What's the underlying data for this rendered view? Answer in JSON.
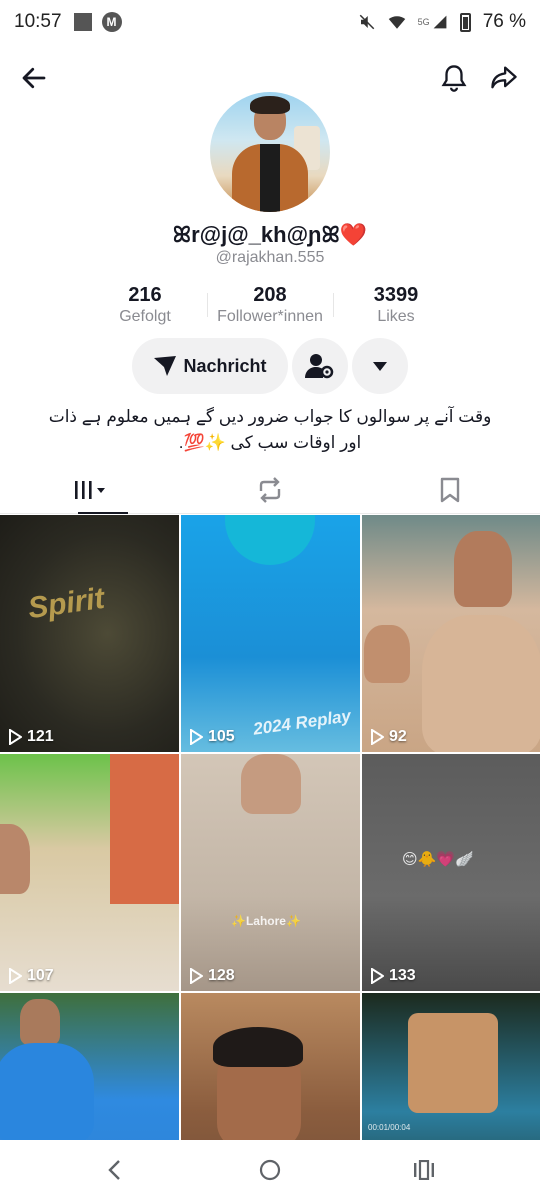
{
  "status_bar": {
    "time": "10:57",
    "battery": "76 %",
    "network": "5G"
  },
  "top_nav": {
    "back_icon": "arrow-left-icon",
    "notification_icon": "bell-icon",
    "share_icon": "share-arrow-icon"
  },
  "profile": {
    "display_name": "ꕤr@j@_kh@ɲꕤ❤️",
    "username": "@rajakhan.555",
    "stats": [
      {
        "value": "216",
        "label": "Gefolgt"
      },
      {
        "value": "208",
        "label": "Follower*innen"
      },
      {
        "value": "3399",
        "label": "Likes"
      }
    ],
    "message_button": "Nachricht",
    "bio_line1": "وقت آنے پر سوالوں کا جواب ضرور دیں گے ہمیں معلوم ہے ذات",
    "bio_line2": "اور اوقات سب کی ✨💯."
  },
  "tabs": [
    {
      "name": "videos",
      "icon": "grid-icon",
      "active": true
    },
    {
      "name": "reposts",
      "icon": "repost-icon",
      "active": false
    },
    {
      "name": "saved",
      "icon": "bookmark-icon",
      "active": false
    }
  ],
  "videos": [
    {
      "views": "121",
      "overlay": "Spirit"
    },
    {
      "views": "105",
      "overlay": "2024 Replay"
    },
    {
      "views": "92",
      "overlay": ""
    },
    {
      "views": "107",
      "overlay": ""
    },
    {
      "views": "128",
      "overlay": "✨Lahore✨"
    },
    {
      "views": "133",
      "overlay": "😊🐥💗🪽"
    },
    {
      "views": "",
      "overlay": ""
    },
    {
      "views": "",
      "overlay": ""
    },
    {
      "views": "",
      "overlay": "00:01/00:04"
    }
  ],
  "colors": {
    "accent_text": "#161823",
    "secondary_text": "#8a8b91",
    "button_bg": "#f1f1f2"
  }
}
